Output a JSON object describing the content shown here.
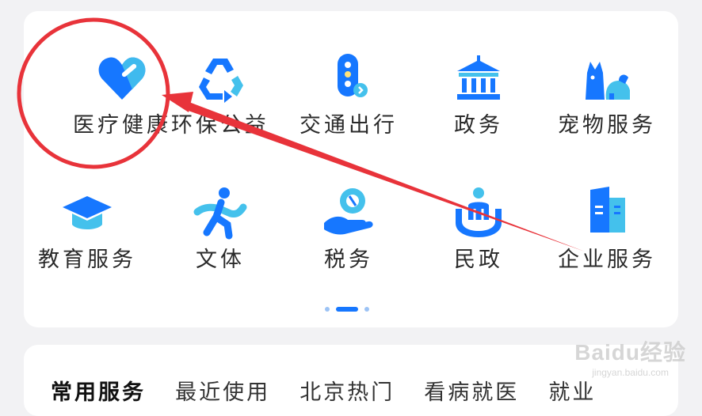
{
  "services": [
    {
      "label": "医疗健康",
      "icon": "heart-bandage-icon"
    },
    {
      "label": "环保公益",
      "icon": "recycle-icon"
    },
    {
      "label": "交通出行",
      "icon": "traffic-light-icon"
    },
    {
      "label": "政务",
      "icon": "government-building-icon"
    },
    {
      "label": "宠物服务",
      "icon": "pet-icon"
    },
    {
      "label": "教育服务",
      "icon": "graduation-cap-icon"
    },
    {
      "label": "文体",
      "icon": "running-person-icon"
    },
    {
      "label": "税务",
      "icon": "hand-coin-icon"
    },
    {
      "label": "民政",
      "icon": "hands-person-icon"
    },
    {
      "label": "企业服务",
      "icon": "office-building-icon"
    }
  ],
  "pager": {
    "count": 3,
    "active": 1
  },
  "tabs": [
    {
      "label": "常用服务",
      "active": true
    },
    {
      "label": "最近使用",
      "active": false
    },
    {
      "label": "北京热门",
      "active": false
    },
    {
      "label": "看病就医",
      "active": false
    },
    {
      "label": "就业",
      "active": false
    }
  ],
  "colors": {
    "primary": "#1677ff",
    "light": "#44c1ec",
    "annotation": "#e8333a",
    "background": "#f2f2f4"
  },
  "watermark": {
    "brand": "Baidu经验",
    "url": "jingyan.baidu.com"
  }
}
